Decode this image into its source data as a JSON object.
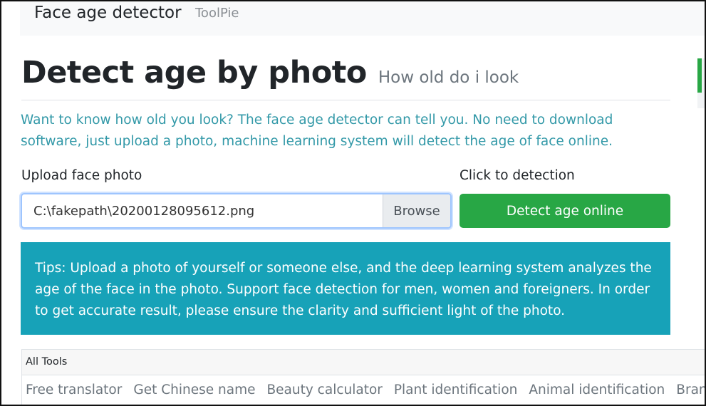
{
  "navbar": {
    "brand": "Face age detector",
    "link": "ToolPie"
  },
  "page": {
    "title": "Detect age by photo",
    "subtitle": "How old do i look",
    "intro": "Want to know how old you look? The face age detector can tell you. No need to download software, just upload a photo, machine learning system will detect the age of face online."
  },
  "upload": {
    "label": "Upload face photo",
    "file_value": "C:\\fakepath\\20200128095612.png",
    "browse_label": "Browse"
  },
  "detect": {
    "label": "Click to detection",
    "button_label": "Detect age online"
  },
  "tips": {
    "text": "Tips: Upload a photo of yourself or someone else, and the deep learning system analyzes the age of the face in the photo. Support face detection for men, women and foreigners. In order to get accurate result, please ensure the clarity and sufficient light of the photo."
  },
  "tools": {
    "header": "All Tools",
    "items": [
      {
        "label": "Free translator"
      },
      {
        "label": "Get Chinese name"
      },
      {
        "label": "Beauty calculator"
      },
      {
        "label": "Plant identification"
      },
      {
        "label": "Animal identification"
      },
      {
        "label": "Brand logo"
      }
    ]
  },
  "colors": {
    "primary_button": "#28a745",
    "tips_background": "#17a2b8",
    "intro_text": "#3399a8"
  }
}
